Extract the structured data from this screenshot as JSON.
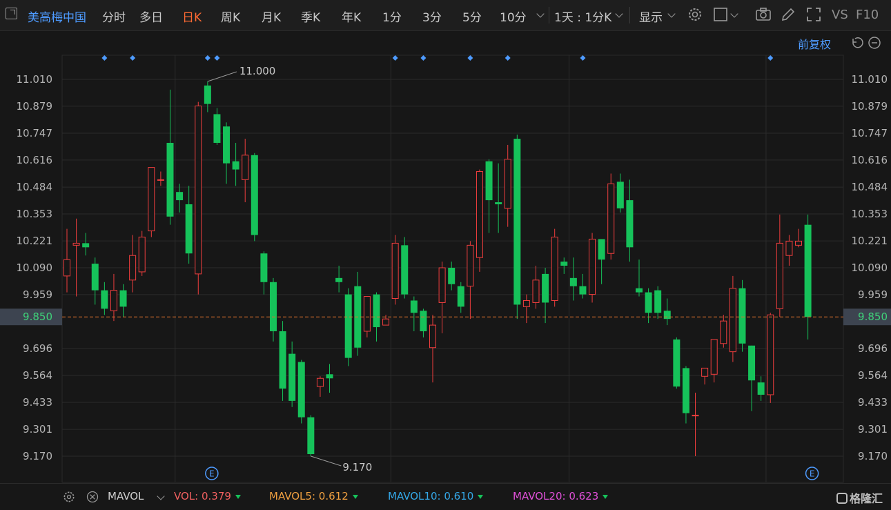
{
  "toolbar": {
    "stock_name": "美高梅中国",
    "tabs": [
      "分时",
      "多日",
      "日K",
      "周K",
      "月K",
      "季K",
      "年K",
      "1分",
      "3分",
      "5分",
      "10分"
    ],
    "active_tab": "日K",
    "period_select": "1天 : 1分K",
    "display_label": "显示",
    "vs_label": "VS",
    "f10_label": "F10"
  },
  "chart": {
    "adjust_label": "前复权",
    "current_price_label": "9.850",
    "max_label": "11.000",
    "min_label": "9.170",
    "event_marker": "E",
    "colors": {
      "up": "#f03e3e",
      "down": "#16c25a",
      "price_line": "#e0722f",
      "axis_text": "#b5b5b5",
      "highlight": "#3d4450"
    }
  },
  "chart_data": {
    "type": "candlestick",
    "y_ticks": [
      "11.010",
      "10.879",
      "10.747",
      "10.616",
      "10.484",
      "10.353",
      "10.221",
      "10.090",
      "9.959",
      "9.850",
      "9.696",
      "9.564",
      "9.433",
      "9.301",
      "9.170"
    ],
    "ylim": [
      9.135,
      11.12
    ],
    "current_price": 9.85,
    "max_price": 11.0,
    "min_price": 9.17,
    "candles": [
      {
        "o": 10.05,
        "h": 10.28,
        "c": 10.13,
        "l": 9.97
      },
      {
        "o": 10.2,
        "h": 10.33,
        "c": 10.21,
        "l": 9.95
      },
      {
        "o": 10.21,
        "h": 10.26,
        "c": 10.19,
        "l": 10.15
      },
      {
        "o": 10.11,
        "h": 10.14,
        "c": 9.98,
        "l": 9.91
      },
      {
        "o": 9.98,
        "h": 10.02,
        "c": 9.89,
        "l": 9.86
      },
      {
        "o": 9.88,
        "h": 10.06,
        "c": 9.98,
        "l": 9.83
      },
      {
        "o": 9.98,
        "h": 10.01,
        "c": 9.9,
        "l": 9.85
      },
      {
        "o": 10.03,
        "h": 10.25,
        "c": 10.15,
        "l": 9.97
      },
      {
        "o": 10.07,
        "h": 10.27,
        "c": 10.24,
        "l": 10.05
      },
      {
        "o": 10.27,
        "h": 10.56,
        "c": 10.58,
        "l": 10.24
      },
      {
        "o": 10.52,
        "h": 10.56,
        "c": 10.52,
        "l": 10.49
      },
      {
        "o": 10.7,
        "h": 10.96,
        "c": 10.34,
        "l": 10.3
      },
      {
        "o": 10.46,
        "h": 10.5,
        "c": 10.42,
        "l": 10.36
      },
      {
        "o": 10.4,
        "h": 10.49,
        "c": 10.16,
        "l": 10.11
      },
      {
        "o": 10.06,
        "h": 10.9,
        "c": 10.88,
        "l": 9.96
      },
      {
        "o": 10.98,
        "h": 11.0,
        "c": 10.89,
        "l": 10.85
      },
      {
        "o": 10.84,
        "h": 10.87,
        "c": 10.7,
        "l": 10.69
      },
      {
        "o": 10.78,
        "h": 10.8,
        "c": 10.6,
        "l": 10.5
      },
      {
        "o": 10.61,
        "h": 10.7,
        "c": 10.57,
        "l": 10.49
      },
      {
        "o": 10.52,
        "h": 10.72,
        "c": 10.64,
        "l": 10.41
      },
      {
        "o": 10.64,
        "h": 10.65,
        "c": 10.25,
        "l": 10.22
      },
      {
        "o": 10.16,
        "h": 10.17,
        "c": 10.02,
        "l": 9.96
      },
      {
        "o": 10.02,
        "h": 10.04,
        "c": 9.78,
        "l": 9.73
      },
      {
        "o": 9.78,
        "h": 9.83,
        "c": 9.5,
        "l": 9.44
      },
      {
        "o": 9.67,
        "h": 9.73,
        "c": 9.44,
        "l": 9.41
      },
      {
        "o": 9.63,
        "h": 9.64,
        "c": 9.36,
        "l": 9.33
      },
      {
        "o": 9.36,
        "h": 9.37,
        "c": 9.18,
        "l": 9.17
      },
      {
        "o": 9.51,
        "h": 9.56,
        "c": 9.55,
        "l": 9.46
      },
      {
        "o": 9.57,
        "h": 9.62,
        "c": 9.55,
        "l": 9.48
      },
      {
        "o": 10.04,
        "h": 10.1,
        "c": 10.02,
        "l": 9.97
      },
      {
        "o": 9.96,
        "h": 9.99,
        "c": 9.65,
        "l": 9.61
      },
      {
        "o": 10.0,
        "h": 10.07,
        "c": 9.7,
        "l": 9.66
      },
      {
        "o": 9.78,
        "h": 9.95,
        "c": 9.95,
        "l": 9.75
      },
      {
        "o": 9.96,
        "h": 9.97,
        "c": 9.8,
        "l": 9.73
      },
      {
        "o": 9.81,
        "h": 9.86,
        "c": 9.84,
        "l": 9.81
      },
      {
        "o": 9.94,
        "h": 10.25,
        "c": 10.21,
        "l": 9.91
      },
      {
        "o": 10.2,
        "h": 10.24,
        "c": 9.96,
        "l": 9.94
      },
      {
        "o": 9.93,
        "h": 9.95,
        "c": 9.87,
        "l": 9.78
      },
      {
        "o": 9.88,
        "h": 9.89,
        "c": 9.78,
        "l": 9.75
      },
      {
        "o": 9.7,
        "h": 9.86,
        "c": 9.81,
        "l": 9.53
      },
      {
        "o": 9.92,
        "h": 10.12,
        "c": 10.09,
        "l": 9.77
      },
      {
        "o": 10.09,
        "h": 10.12,
        "c": 10.01,
        "l": 9.98
      },
      {
        "o": 10.0,
        "h": 10.02,
        "c": 9.9,
        "l": 9.87
      },
      {
        "o": 10.0,
        "h": 10.22,
        "c": 10.2,
        "l": 9.84
      },
      {
        "o": 10.14,
        "h": 10.57,
        "c": 10.56,
        "l": 10.07
      },
      {
        "o": 10.61,
        "h": 10.62,
        "c": 10.42,
        "l": 10.26
      },
      {
        "o": 10.41,
        "h": 10.6,
        "c": 10.4,
        "l": 10.26
      },
      {
        "o": 10.38,
        "h": 10.69,
        "c": 10.62,
        "l": 10.29
      },
      {
        "o": 10.72,
        "h": 10.74,
        "c": 9.91,
        "l": 9.84
      },
      {
        "o": 9.9,
        "h": 9.96,
        "c": 9.93,
        "l": 9.82
      },
      {
        "o": 9.92,
        "h": 10.1,
        "c": 10.03,
        "l": 9.89
      },
      {
        "o": 10.06,
        "h": 10.09,
        "c": 9.92,
        "l": 9.82
      },
      {
        "o": 9.93,
        "h": 10.28,
        "c": 10.24,
        "l": 9.9
      },
      {
        "o": 10.12,
        "h": 10.14,
        "c": 10.1,
        "l": 10.06
      },
      {
        "o": 10.04,
        "h": 10.14,
        "c": 10.0,
        "l": 9.93
      },
      {
        "o": 10.0,
        "h": 10.06,
        "c": 9.96,
        "l": 9.94
      },
      {
        "o": 9.96,
        "h": 10.26,
        "c": 10.23,
        "l": 9.92
      },
      {
        "o": 10.23,
        "h": 10.23,
        "c": 10.13,
        "l": 10.01
      },
      {
        "o": 10.16,
        "h": 10.55,
        "c": 10.5,
        "l": 10.13
      },
      {
        "o": 10.51,
        "h": 10.55,
        "c": 10.38,
        "l": 10.36
      },
      {
        "o": 10.42,
        "h": 10.52,
        "c": 10.19,
        "l": 10.12
      },
      {
        "o": 9.99,
        "h": 10.13,
        "c": 9.97,
        "l": 9.95
      },
      {
        "o": 9.97,
        "h": 9.99,
        "c": 9.87,
        "l": 9.82
      },
      {
        "o": 9.98,
        "h": 10.0,
        "c": 9.87,
        "l": 9.84
      },
      {
        "o": 9.88,
        "h": 9.94,
        "c": 9.84,
        "l": 9.81
      },
      {
        "o": 9.74,
        "h": 9.75,
        "c": 9.51,
        "l": 9.5
      },
      {
        "o": 9.6,
        "h": 9.61,
        "c": 9.38,
        "l": 9.33
      },
      {
        "o": 9.37,
        "h": 9.48,
        "c": 9.37,
        "l": 9.17
      },
      {
        "o": 9.56,
        "h": 9.59,
        "c": 9.6,
        "l": 9.52
      },
      {
        "o": 9.57,
        "h": 9.74,
        "c": 9.74,
        "l": 9.53
      },
      {
        "o": 9.72,
        "h": 9.86,
        "c": 9.83,
        "l": 9.7
      },
      {
        "o": 9.68,
        "h": 10.05,
        "c": 9.99,
        "l": 9.63
      },
      {
        "o": 9.99,
        "h": 10.03,
        "c": 9.72,
        "l": 9.68
      },
      {
        "o": 9.71,
        "h": 9.71,
        "c": 9.54,
        "l": 9.39
      },
      {
        "o": 9.53,
        "h": 9.56,
        "c": 9.47,
        "l": 9.44
      },
      {
        "o": 9.47,
        "h": 9.87,
        "c": 9.86,
        "l": 9.43
      },
      {
        "o": 9.89,
        "h": 10.35,
        "c": 10.21,
        "l": 9.85
      },
      {
        "o": 10.15,
        "h": 10.25,
        "c": 10.22,
        "l": 10.1
      },
      {
        "o": 10.2,
        "h": 10.28,
        "c": 10.22,
        "l": 10.19
      },
      {
        "o": 10.3,
        "h": 10.35,
        "c": 9.85,
        "l": 9.74
      }
    ],
    "event_diamonds_candle_index": [
      4,
      7,
      15,
      16,
      35,
      38,
      43,
      47,
      55,
      75
    ],
    "event_markers_candle_index": [
      15,
      79
    ],
    "x_gridlines_candle_index": [
      12,
      35,
      54,
      75
    ]
  },
  "volume_bar": {
    "indicator": "MAVOL",
    "items": [
      {
        "label": "VOL:",
        "value": "0.379",
        "color": "#f06060"
      },
      {
        "label": "MAVOL5:",
        "value": "0.612",
        "color": "#f0a040"
      },
      {
        "label": "MAVOL10:",
        "value": "0.610",
        "color": "#34a8e8"
      },
      {
        "label": "MAVOL20:",
        "value": "0.623",
        "color": "#e050d8"
      }
    ],
    "brand": "格隆汇"
  }
}
